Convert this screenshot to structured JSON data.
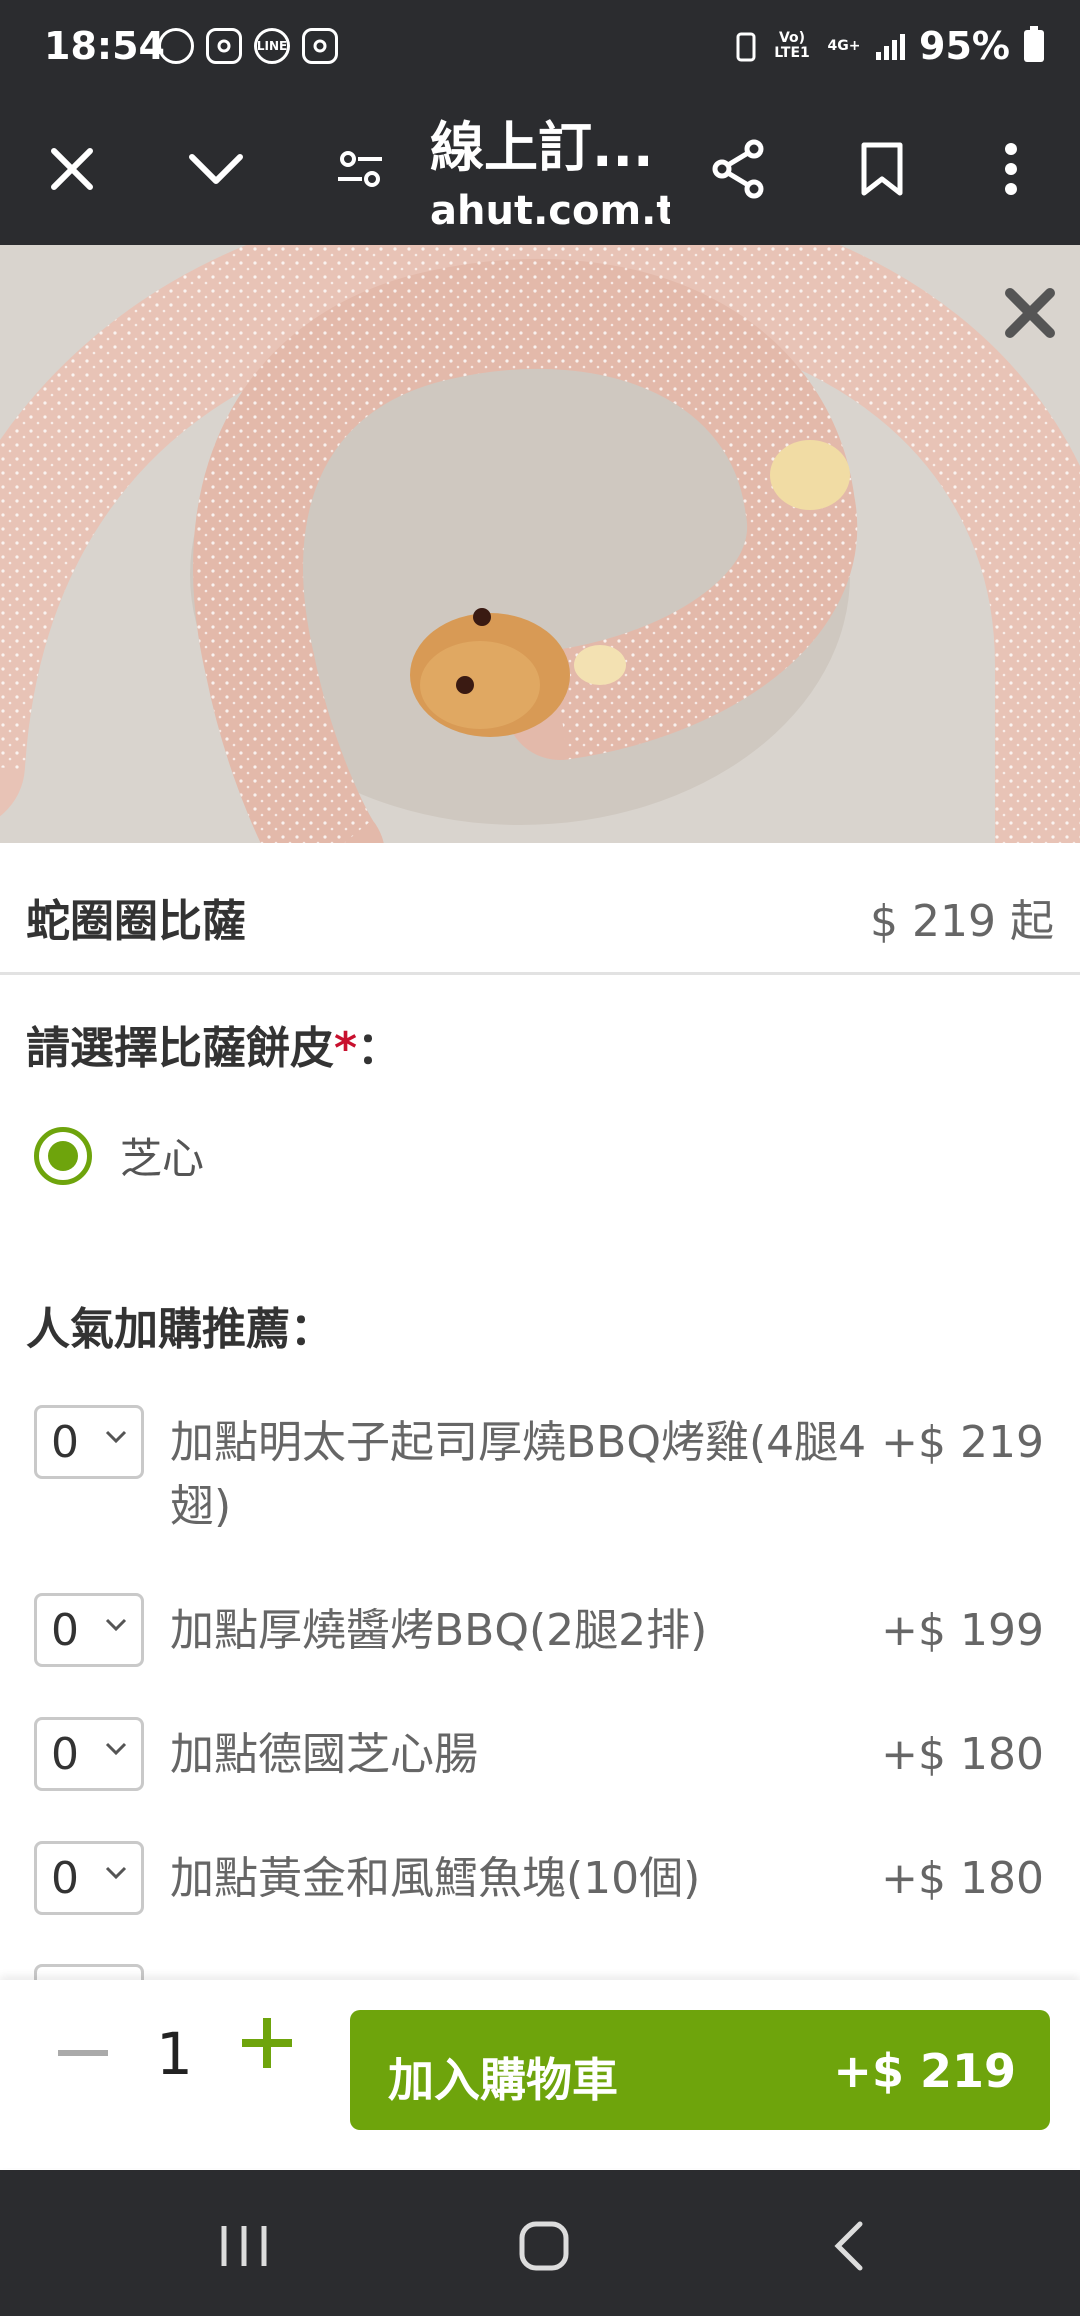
{
  "status_bar": {
    "time": "18:54",
    "notif_icons": [
      "messenger-icon",
      "instagram-icon",
      "line-icon",
      "instagram-icon"
    ],
    "line_label": "LINE",
    "volte_label": "Vo) LTE1",
    "network_label": "4G+",
    "battery": "95%"
  },
  "browser": {
    "page_title": "線上訂...",
    "url": "ahut.com.tw"
  },
  "product": {
    "name": "蛇圈圈比薩",
    "price": "$ 219 起"
  },
  "crust_section": {
    "title": "請選擇比薩餅皮",
    "required_mark": "*",
    "colon": "：",
    "options": [
      {
        "label": "芝心",
        "selected": true
      }
    ]
  },
  "addons_section": {
    "title": "人氣加購推薦：",
    "items": [
      {
        "qty": "0",
        "label": "加點明太子起司厚燒BBQ烤雞(4腿4翅)",
        "price": "+$ 219"
      },
      {
        "qty": "0",
        "label": "加點厚燒醬烤BBQ(2腿2排)",
        "price": "+$ 199"
      },
      {
        "qty": "0",
        "label": "加點德國芝心腸",
        "price": "+$ 180"
      },
      {
        "qty": "0",
        "label": "加點黃金和風鱈魚塊(10個)",
        "price": "+$ 180"
      }
    ]
  },
  "cart_bar": {
    "quantity": "1",
    "add_label": "加入購物車",
    "total": "+$ 219"
  },
  "colors": {
    "accent_green": "#6ea40c",
    "required_red": "#c8102e",
    "dark_bar": "#2b2c2f"
  }
}
